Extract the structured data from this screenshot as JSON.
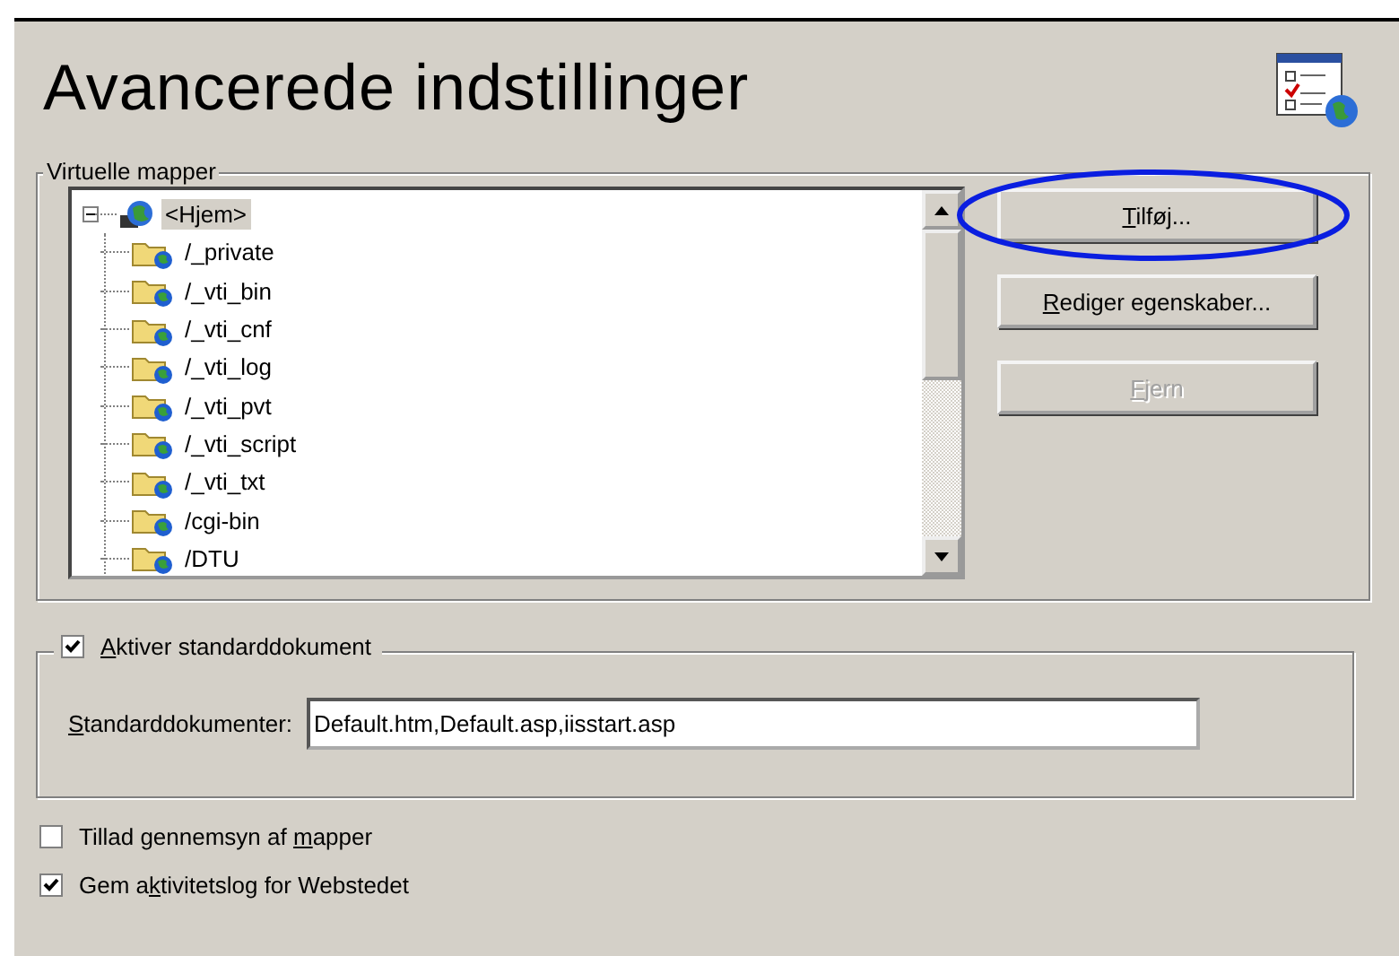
{
  "title": "Avancerede indstillinger",
  "virtual_folders": {
    "legend": "Virtuelle mapper",
    "tree": [
      {
        "label": "<Hjem>",
        "kind": "site",
        "selected": true,
        "expanded": true,
        "children": [
          {
            "label": "/_private",
            "kind": "folder",
            "selected": false
          },
          {
            "label": "/_vti_bin",
            "kind": "folder",
            "selected": false
          },
          {
            "label": "/_vti_cnf",
            "kind": "folder",
            "selected": false
          },
          {
            "label": "/_vti_log",
            "kind": "folder",
            "selected": false
          },
          {
            "label": "/_vti_pvt",
            "kind": "folder",
            "selected": false
          },
          {
            "label": "/_vti_script",
            "kind": "folder",
            "selected": false
          },
          {
            "label": "/_vti_txt",
            "kind": "folder",
            "selected": false
          },
          {
            "label": "/cgi-bin",
            "kind": "folder",
            "selected": false
          },
          {
            "label": "/DTU",
            "kind": "folder",
            "selected": false
          }
        ]
      }
    ],
    "buttons": [
      {
        "key": "T",
        "post": "ilføj...",
        "disabled": false,
        "circled": true
      },
      {
        "key": "R",
        "post": "ediger egenskaber...",
        "disabled": false,
        "circled": false
      },
      {
        "key": "F",
        "post": "jern",
        "disabled": true,
        "circled": false
      }
    ]
  },
  "default_document": {
    "checkbox": {
      "key": "A",
      "post": "ktiver standarddokument",
      "checked": true
    },
    "field_label": {
      "key": "S",
      "post": "tandarddokumenter:"
    },
    "value": "Default.htm,Default.asp,iisstart.asp"
  },
  "options": [
    {
      "pre": "Tillad gennemsyn af ",
      "key": "m",
      "post": "apper",
      "checked": false
    },
    {
      "pre": "Gem a",
      "key": "k",
      "post": "tivitetslog for Webstedet",
      "checked": true
    }
  ]
}
